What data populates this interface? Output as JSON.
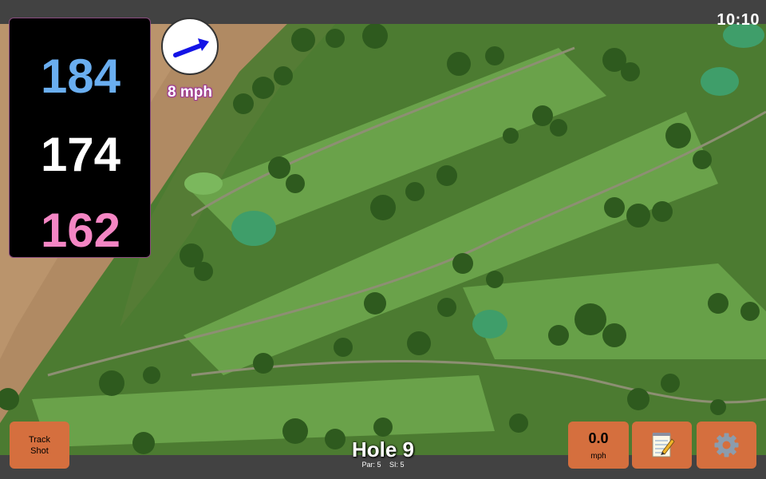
{
  "status": {
    "time": "10:10"
  },
  "yardage": {
    "back": "184",
    "middle": "174",
    "front": "162"
  },
  "wind": {
    "speed_label": "8 mph",
    "arrow_icon": "arrow-right-icon"
  },
  "colors": {
    "back": "#6aaef0",
    "middle": "#ffffff",
    "front": "#f486c4",
    "button": "#d56f3e",
    "wind_glow": "#a03a96"
  },
  "buttons": {
    "track_shot_line1": "Track",
    "track_shot_line2": "Shot",
    "speed_value": "0.0",
    "speed_unit": "mph",
    "notes_icon": "notepad-icon",
    "settings_icon": "gear-icon"
  },
  "hole": {
    "title": "Hole 9",
    "par": "Par: 5",
    "si": "SI: 5"
  }
}
